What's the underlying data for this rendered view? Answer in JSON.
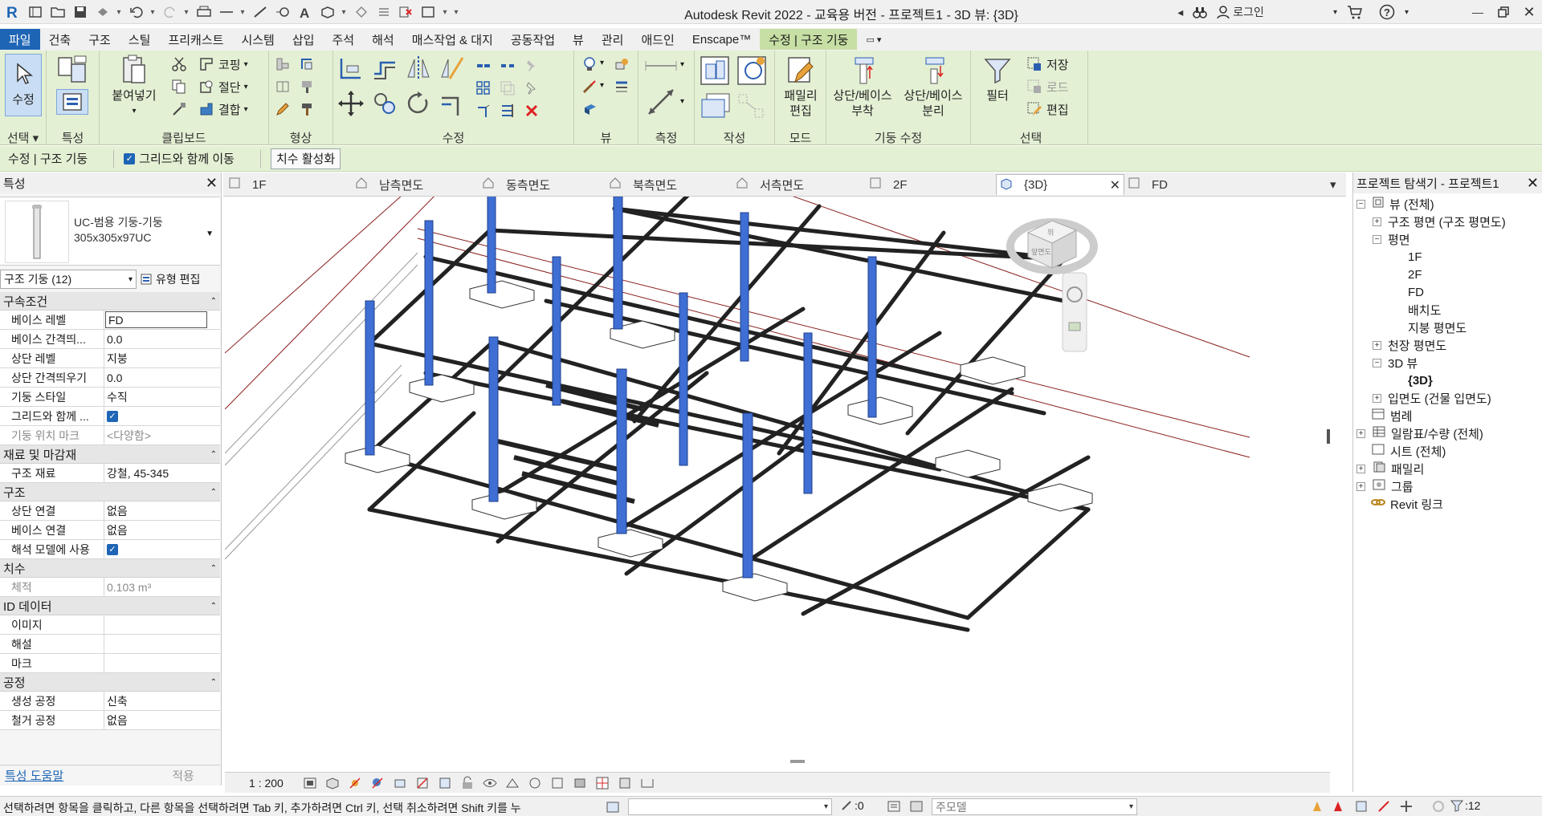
{
  "app": {
    "title": "Autodesk Revit 2022 - 교육용 버전 - 프로젝트1 - 3D 뷰: {3D}",
    "signin_label": "로그인"
  },
  "menu_tabs": [
    "파일",
    "건축",
    "구조",
    "스틸",
    "프리캐스트",
    "시스템",
    "삽입",
    "주석",
    "해석",
    "매스작업 & 대지",
    "공동작업",
    "뷰",
    "관리",
    "애드인",
    "Enscape™",
    "수정 | 구조 기둥"
  ],
  "ribbon": {
    "panels": {
      "select": "선택",
      "properties": "특성",
      "clipboard": "클립보드",
      "geometry": "형상",
      "modify": "수정",
      "view": "뷰",
      "measure": "측정",
      "create": "작성",
      "mode": "모드",
      "column_modify": "기둥 수정",
      "selection": "선택"
    },
    "modify_label": "수정",
    "paste_label": "붙여넣기",
    "cope_label": "코핑",
    "cut_label": "절단",
    "join_label": "결합",
    "edit_family_label": "패밀리\n편집",
    "attach_label": "상단/베이스\n부착",
    "detach_label": "상단/베이스\n분리",
    "filter_label": "필터",
    "save_label": "저장",
    "load_label": "로드",
    "edit_label": "편집"
  },
  "options_bar": {
    "context": "수정 | 구조 기둥",
    "move_with_grids": "그리드와 함께 이동",
    "activate_dimensions": "치수 활성화"
  },
  "properties": {
    "header": "특성",
    "type_family": "UC-범용 기둥-기둥",
    "type_name": "305x305x97UC",
    "filter": "구조 기둥 (12)",
    "edit_type": "유형 편집",
    "groups": [
      {
        "name": "구속조건",
        "rows": [
          {
            "k": "베이스 레벨",
            "v": "FD"
          },
          {
            "k": "베이스 간격띄...",
            "v": "0.0"
          },
          {
            "k": "상단 레벨",
            "v": "지붕"
          },
          {
            "k": "상단 간격띄우기",
            "v": "0.0"
          },
          {
            "k": "기둥 스타일",
            "v": "수직"
          },
          {
            "k": "그리드와 함께 ...",
            "v": ""
          },
          {
            "k": "기둥 위치 마크",
            "v": "<다양함>"
          }
        ]
      },
      {
        "name": "재료 및 마감재",
        "rows": [
          {
            "k": "구조 재료",
            "v": "강철, 45-345"
          }
        ]
      },
      {
        "name": "구조",
        "rows": [
          {
            "k": "상단 연결",
            "v": "없음"
          },
          {
            "k": "베이스 연결",
            "v": "없음"
          },
          {
            "k": "해석 모델에 사용",
            "v": ""
          }
        ]
      },
      {
        "name": "치수",
        "rows": [
          {
            "k": "체적",
            "v": "0.103 m³"
          }
        ]
      },
      {
        "name": "ID 데이터",
        "rows": [
          {
            "k": "이미지",
            "v": ""
          },
          {
            "k": "해설",
            "v": ""
          },
          {
            "k": "마크",
            "v": ""
          }
        ]
      },
      {
        "name": "공정",
        "rows": [
          {
            "k": "생성 공정",
            "v": "신축"
          },
          {
            "k": "철거 공정",
            "v": "없음"
          }
        ]
      }
    ],
    "help_link": "특성 도움말",
    "apply": "적용"
  },
  "view_tabs": [
    "1F",
    "남측면도",
    "동측면도",
    "북측면도",
    "서측면도",
    "2F",
    "{3D}",
    "FD"
  ],
  "viewcube_labels": {
    "top": "위",
    "front": "앞면도"
  },
  "view_scale": "1 : 200",
  "browser": {
    "header": "프로젝트 탐색기 - 프로젝트1",
    "nodes": [
      {
        "label": "뷰 (전체)",
        "level": 0,
        "toggle": "−"
      },
      {
        "label": "구조 평면 (구조 평면도)",
        "level": 1,
        "toggle": "+"
      },
      {
        "label": "평면",
        "level": 1,
        "toggle": "−"
      },
      {
        "label": "1F",
        "level": 2,
        "toggle": ""
      },
      {
        "label": "2F",
        "level": 2,
        "toggle": ""
      },
      {
        "label": "FD",
        "level": 2,
        "toggle": ""
      },
      {
        "label": "배치도",
        "level": 2,
        "toggle": ""
      },
      {
        "label": "지붕 평면도",
        "level": 2,
        "toggle": ""
      },
      {
        "label": "천장 평면도",
        "level": 1,
        "toggle": "+"
      },
      {
        "label": "3D 뷰",
        "level": 1,
        "toggle": "−"
      },
      {
        "label": "{3D}",
        "level": 2,
        "toggle": ""
      },
      {
        "label": "입면도 (건물 입면도)",
        "level": 1,
        "toggle": "+"
      },
      {
        "label": "범례",
        "level": 0,
        "toggle": ""
      },
      {
        "label": "일람표/수량 (전체)",
        "level": 0,
        "toggle": "+"
      },
      {
        "label": "시트 (전체)",
        "level": 0,
        "toggle": ""
      },
      {
        "label": "패밀리",
        "level": 0,
        "toggle": "+"
      },
      {
        "label": "그룹",
        "level": 0,
        "toggle": "+"
      },
      {
        "label": "Revit 링크",
        "level": 0,
        "toggle": ""
      }
    ]
  },
  "status": {
    "message": "선택하려면 항목을 클릭하고, 다른 항목을 선택하려면 Tab 키, 추가하려면 Ctrl 키, 선택 취소하려면 Shift 키를 누",
    "coord": ":0",
    "model": "주모델",
    "filter_count": ":12"
  },
  "colors": {
    "accent": "#1e65b5",
    "ribbon_context": "#e4f0d4",
    "column_blue": "#3f6fd4"
  }
}
